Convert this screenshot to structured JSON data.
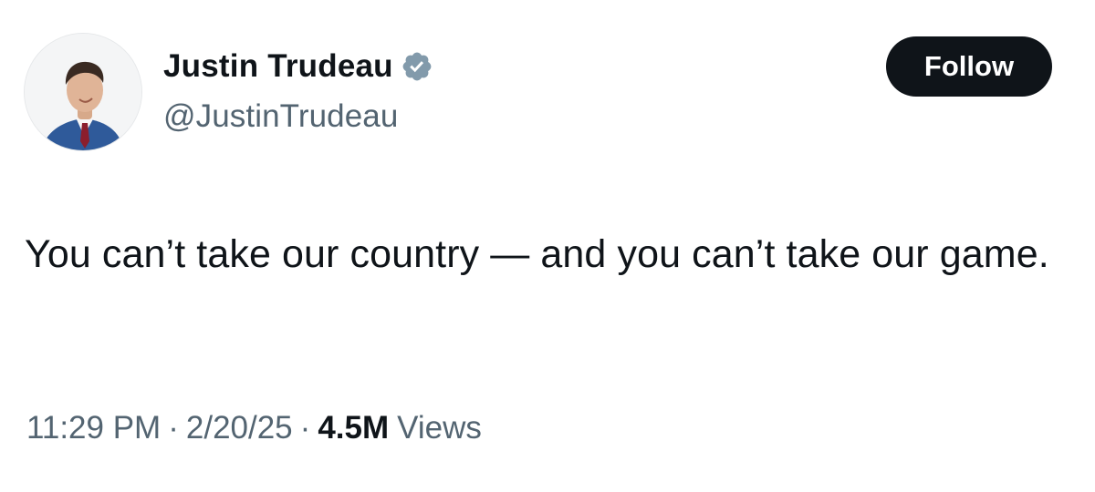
{
  "author": {
    "display_name": "Justin Trudeau",
    "handle": "@JustinTrudeau",
    "avatar_icon": "profile-photo",
    "verified_icon": "verified-badge-icon",
    "verified_color": "#829aab"
  },
  "follow_button": {
    "label": "Follow",
    "background": "#0f1419",
    "text_color": "#ffffff"
  },
  "tweet": {
    "text": "You can’t take our country — and you can’t take our game."
  },
  "meta": {
    "time": "11:29 PM",
    "separator": "·",
    "date": "2/20/25",
    "views_count": "4.5M",
    "views_label": "Views"
  }
}
